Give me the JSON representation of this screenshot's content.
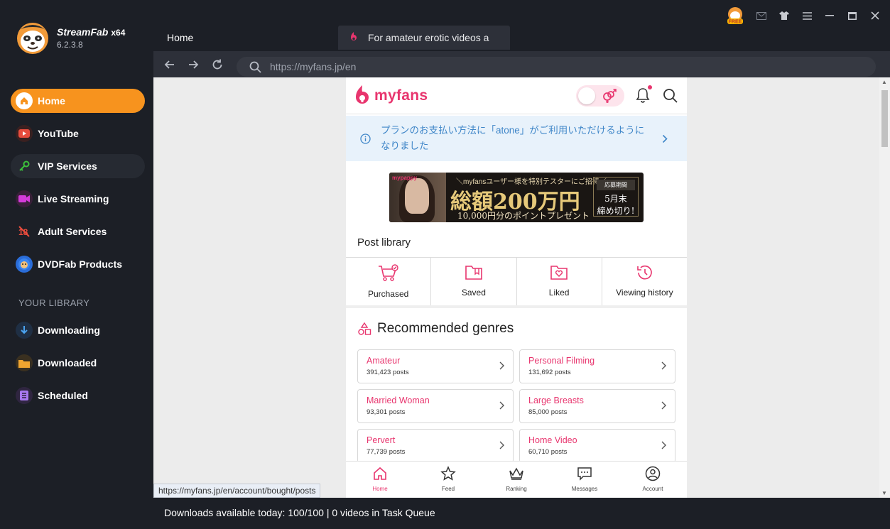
{
  "app": {
    "brand": "StreamFab",
    "arch": "x64",
    "version": "6.2.3.8",
    "free_badge": "FREE"
  },
  "sidebar": {
    "items": [
      {
        "label": "Home",
        "icon": "home-icon"
      },
      {
        "label": "YouTube",
        "icon": "youtube-icon"
      },
      {
        "label": "VIP Services",
        "icon": "key-icon"
      },
      {
        "label": "Live Streaming",
        "icon": "video-camera-icon"
      },
      {
        "label": "Adult Services",
        "icon": "adult-icon"
      },
      {
        "label": "DVDFab Products",
        "icon": "dvdfab-icon"
      }
    ],
    "library_title": "YOUR LIBRARY",
    "library": [
      {
        "label": "Downloading",
        "icon": "download-arrow-icon"
      },
      {
        "label": "Downloaded",
        "icon": "folder-icon"
      },
      {
        "label": "Scheduled",
        "icon": "schedule-list-icon"
      }
    ]
  },
  "tabs": {
    "home": "Home",
    "active": "For amateur erotic videos a"
  },
  "address": {
    "url": "https://myfans.jp/en"
  },
  "site": {
    "logo": "myfans",
    "notice": "プランのお支払い方法に「atone」がご利用いただけるようになりました",
    "banner": {
      "brand": "mypappy",
      "top": "＼myfansユーザー様を特別テスターにご招待／",
      "main": "総額200万円",
      "sub": "10,000円分のポイントプレゼント",
      "box_tag": "応募期間",
      "box_line1": "5月末",
      "box_line2": "締め切り!"
    },
    "post_library_title": "Post library",
    "post_library": [
      {
        "label": "Purchased"
      },
      {
        "label": "Saved"
      },
      {
        "label": "Liked"
      },
      {
        "label": "Viewing history"
      }
    ],
    "genres_title": "Recommended genres",
    "genres": [
      {
        "name": "Amateur",
        "count": "391,423 posts"
      },
      {
        "name": "Personal Filming",
        "count": "131,692 posts"
      },
      {
        "name": "Married Woman",
        "count": "93,301 posts"
      },
      {
        "name": "Large Breasts",
        "count": "85,000 posts"
      },
      {
        "name": "Pervert",
        "count": "77,739 posts"
      },
      {
        "name": "Home Video",
        "count": "60,710 posts"
      }
    ],
    "bottom_nav": [
      {
        "label": "Home"
      },
      {
        "label": "Feed"
      },
      {
        "label": "Ranking"
      },
      {
        "label": "Messages"
      },
      {
        "label": "Account"
      }
    ]
  },
  "status_url": "https://myfans.jp/en/account/bought/posts",
  "footer": "Downloads available today: 100/100 | 0 videos in Task Queue",
  "colors": {
    "accent": "#f7931e",
    "myfans_pink": "#e8356e",
    "notice_blue": "#3f86c8"
  }
}
